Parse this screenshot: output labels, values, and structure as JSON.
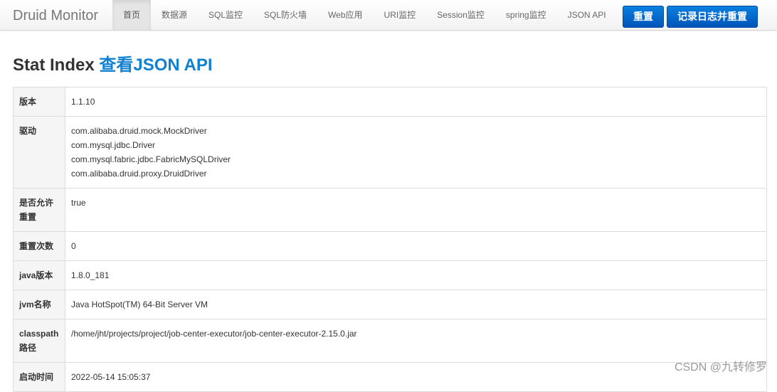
{
  "navbar": {
    "brand": "Druid Monitor",
    "items": [
      {
        "label": "首页",
        "active": true
      },
      {
        "label": "数据源"
      },
      {
        "label": "SQL监控"
      },
      {
        "label": "SQL防火墙"
      },
      {
        "label": "Web应用"
      },
      {
        "label": "URI监控"
      },
      {
        "label": "Session监控"
      },
      {
        "label": "spring监控"
      },
      {
        "label": "JSON API"
      }
    ],
    "reset_button": "重置",
    "log_reset_button": "记录日志并重置"
  },
  "page": {
    "title": "Stat Index",
    "json_link": "查看JSON API"
  },
  "stats": {
    "version": {
      "label": "版本",
      "value": "1.1.10"
    },
    "drivers": {
      "label": "驱动",
      "values": [
        "com.alibaba.druid.mock.MockDriver",
        "com.mysql.jdbc.Driver",
        "com.mysql.fabric.jdbc.FabricMySQLDriver",
        "com.alibaba.druid.proxy.DruidDriver"
      ]
    },
    "reset_enable": {
      "label": "是否允许重置",
      "value": "true"
    },
    "reset_count": {
      "label": "重置次数",
      "value": "0"
    },
    "java_version": {
      "label": "java版本",
      "value": "1.8.0_181"
    },
    "jvm_name": {
      "label": "jvm名称",
      "value": "Java HotSpot(TM) 64-Bit Server VM"
    },
    "classpath": {
      "label": "classpath路径",
      "value": "/home/jht/projects/project/job-center-executor/job-center-executor-2.15.0.jar"
    },
    "start_time": {
      "label": "启动时间",
      "value": "2022-05-14 15:05:37"
    }
  },
  "watermark": "CSDN @九转修罗"
}
